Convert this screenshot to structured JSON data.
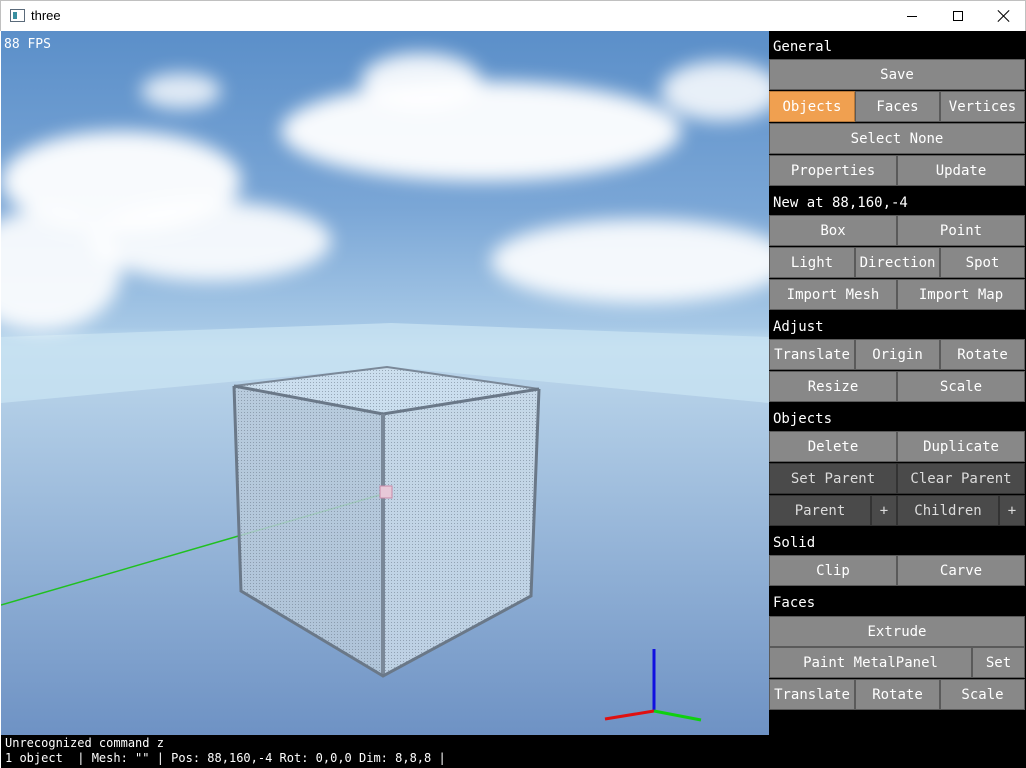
{
  "window": {
    "title": "three"
  },
  "viewport": {
    "fps": "88 FPS"
  },
  "console": {
    "line1": "Unrecognized command z",
    "line2": "1 object  | Mesh: \"\" | Pos: 88,160,-4 Rot: 0,0,0 Dim: 8,8,8 |"
  },
  "panel": {
    "general": {
      "header": "General",
      "save": "Save",
      "objects": "Objects",
      "faces": "Faces",
      "vertices": "Vertices",
      "select_none": "Select None",
      "properties": "Properties",
      "update": "Update"
    },
    "new": {
      "header": "New at 88,160,-4",
      "box": "Box",
      "point": "Point",
      "light": "Light",
      "direction": "Direction",
      "spot": "Spot",
      "import_mesh": "Import Mesh",
      "import_map": "Import Map"
    },
    "adjust": {
      "header": "Adjust",
      "translate": "Translate",
      "origin": "Origin",
      "rotate": "Rotate",
      "resize": "Resize",
      "scale": "Scale"
    },
    "objects": {
      "header": "Objects",
      "delete": "Delete",
      "duplicate": "Duplicate",
      "set_parent": "Set Parent",
      "clear_parent": "Clear Parent",
      "parent": "Parent",
      "parent_plus": "+",
      "children": "Children",
      "children_plus": "+"
    },
    "solid": {
      "header": "Solid",
      "clip": "Clip",
      "carve": "Carve"
    },
    "faces": {
      "header": "Faces",
      "extrude": "Extrude",
      "paint": "Paint MetalPanel",
      "set": "Set",
      "translate": "Translate",
      "rotate": "Rotate",
      "scale": "Scale"
    }
  },
  "colors": {
    "button": "#888888",
    "button_active": "#f0a050",
    "button_disabled": "#4a4a4a",
    "panel_bg": "#000000"
  }
}
